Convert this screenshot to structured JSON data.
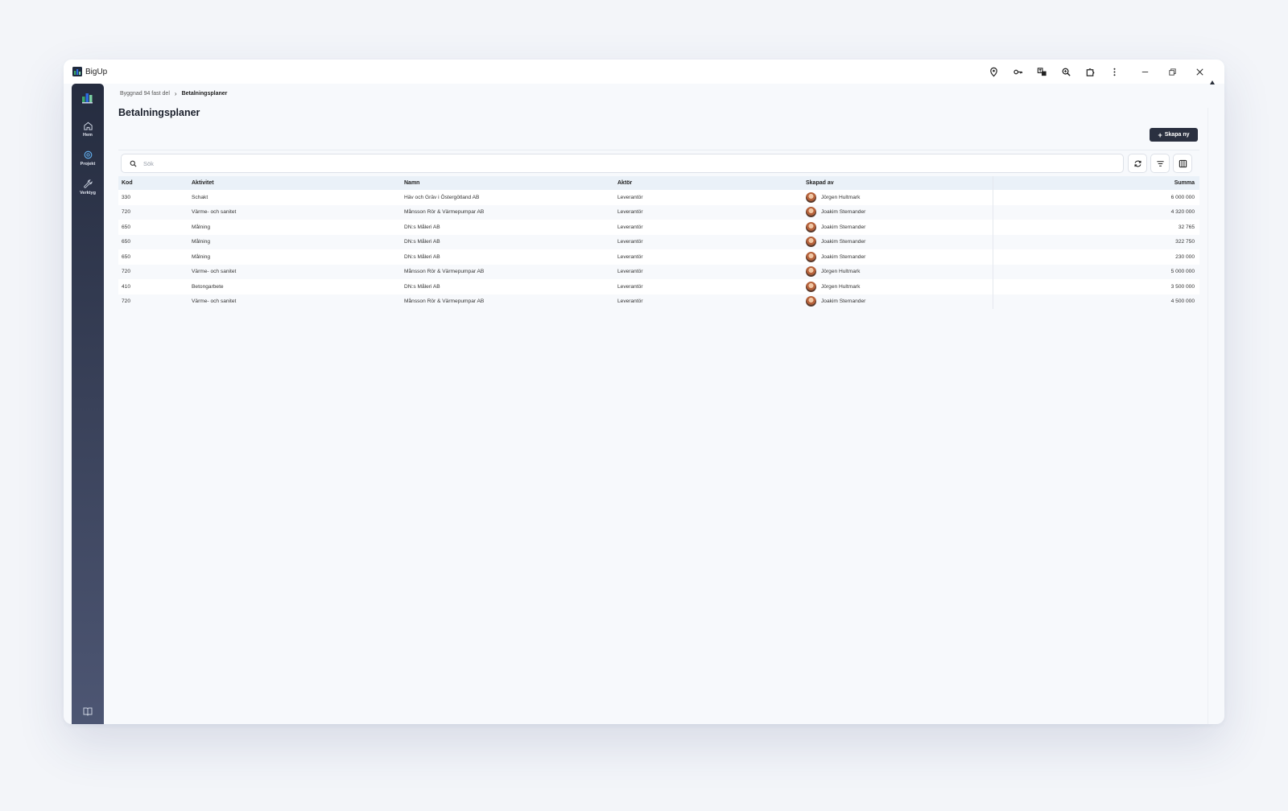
{
  "app": {
    "title": "BigUp"
  },
  "sidebar": {
    "items": [
      {
        "label": "Hem",
        "icon": "home-icon"
      },
      {
        "label": "Projekt",
        "icon": "project-icon"
      },
      {
        "label": "Verktyg",
        "icon": "wrench-icon"
      }
    ],
    "active_index": 1
  },
  "breadcrumb": {
    "parent": "Byggnad 94 fast del",
    "current": "Betalningsplaner"
  },
  "page": {
    "title": "Betalningsplaner",
    "create_label": "Skapa ny"
  },
  "search": {
    "placeholder": "Sök"
  },
  "table": {
    "headers": {
      "kod": "Kod",
      "aktivitet": "Aktivitet",
      "namn": "Namn",
      "aktor": "Aktör",
      "skapad_av": "Skapad av",
      "summa": "Summa"
    },
    "rows": [
      {
        "kod": "330",
        "aktivitet": "Schakt",
        "namn": "Häv och Gräv i Östergötland AB",
        "aktor": "Leverantör",
        "skapad_av": "Jörgen Hultmark",
        "summa": "6 000 000"
      },
      {
        "kod": "720",
        "aktivitet": "Värme- och sanitet",
        "namn": "Månsson Rör & Värmepumpar AB",
        "aktor": "Leverantör",
        "skapad_av": "Joakim Sternander",
        "summa": "4 320 000"
      },
      {
        "kod": "650",
        "aktivitet": "Målning",
        "namn": "DN:s Måleri AB",
        "aktor": "Leverantör",
        "skapad_av": "Joakim Sternander",
        "summa": "32 765"
      },
      {
        "kod": "650",
        "aktivitet": "Målning",
        "namn": "DN:s Måleri AB",
        "aktor": "Leverantör",
        "skapad_av": "Joakim Sternander",
        "summa": "322 750"
      },
      {
        "kod": "650",
        "aktivitet": "Målning",
        "namn": "DN:s Måleri AB",
        "aktor": "Leverantör",
        "skapad_av": "Joakim Sternander",
        "summa": "230 000"
      },
      {
        "kod": "720",
        "aktivitet": "Värme- och sanitet",
        "namn": "Månsson Rör & Värmepumpar AB",
        "aktor": "Leverantör",
        "skapad_av": "Jörgen Hultmark",
        "summa": "5 000 000"
      },
      {
        "kod": "410",
        "aktivitet": "Betongarbete",
        "namn": "DN:s Måleri AB",
        "aktor": "Leverantör",
        "skapad_av": "Jörgen Hultmark",
        "summa": "3 500 000"
      },
      {
        "kod": "720",
        "aktivitet": "Värme- och sanitet",
        "namn": "Månsson Rör & Värmepumpar AB",
        "aktor": "Leverantör",
        "skapad_av": "Joakim Sternander",
        "summa": "4 500 000"
      }
    ]
  },
  "colors": {
    "sidebar_top": "#252c3f",
    "sidebar_bottom": "#4d5673",
    "primary_button": "#2a3040",
    "header_row": "#eaf1f8",
    "logo_green": "#3aa76d",
    "logo_blue": "#2d6cdf"
  }
}
